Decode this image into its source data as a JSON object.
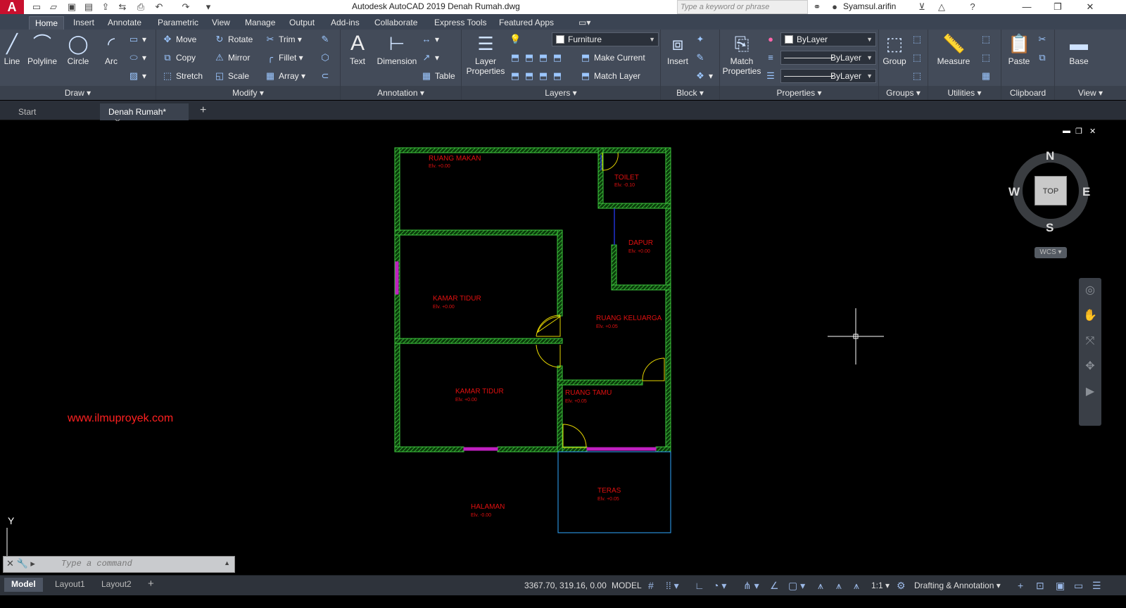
{
  "titlebar": {
    "app_logo": "A",
    "title": "Autodesk AutoCAD 2019    Denah Rumah.dwg",
    "search_placeholder": "Type a keyword or phrase",
    "user": "Syamsul.arifin"
  },
  "ribbon_tabs": [
    "Home",
    "Insert",
    "Annotate",
    "Parametric",
    "View",
    "Manage",
    "Output",
    "Add-ins",
    "Collaborate",
    "Express Tools",
    "Featured Apps"
  ],
  "draw": {
    "title": "Draw",
    "tools": [
      "Line",
      "Polyline",
      "Circle",
      "Arc"
    ]
  },
  "modify": {
    "title": "Modify",
    "tools": [
      "Move",
      "Rotate",
      "Trim",
      "Copy",
      "Mirror",
      "Fillet",
      "Stretch",
      "Scale",
      "Array"
    ]
  },
  "annotation": {
    "title": "Annotation",
    "text": "Text",
    "dimension": "Dimension",
    "table": "Table"
  },
  "layers": {
    "title": "Layers",
    "layer_properties": "Layer Properties",
    "current_layer": "Furniture",
    "make_current": "Make Current",
    "match_layer": "Match Layer"
  },
  "block": {
    "title": "Block",
    "insert": "Insert"
  },
  "properties": {
    "title": "Properties",
    "match_properties": "Match Properties",
    "color": "ByLayer",
    "linetype": "ByLayer",
    "lineweight": "ByLayer"
  },
  "groups": {
    "title": "Groups",
    "group": "Group"
  },
  "utilities": {
    "title": "Utilities",
    "measure": "Measure"
  },
  "clipboard": {
    "title": "Clipboard",
    "paste": "Paste"
  },
  "view_panel": {
    "title": "View",
    "base": "Base"
  },
  "doc_tabs": [
    "Start",
    "Denah Rumah*"
  ],
  "drawing": {
    "rooms": [
      {
        "name": "RUANG MAKAN",
        "elv": "Elv. +0.00"
      },
      {
        "name": "TOILET",
        "elv": "Elv. -0.10"
      },
      {
        "name": "DAPUR",
        "elv": "Elv. +0.00"
      },
      {
        "name": "KAMAR TIDUR",
        "elv": "Elv. +0.00"
      },
      {
        "name": "RUANG KELUARGA",
        "elv": "Elv. +0.05"
      },
      {
        "name": "KAMAR TIDUR",
        "elv": "Elv. +0.00"
      },
      {
        "name": "RUANG TAMU",
        "elv": "Elv. +0.05"
      },
      {
        "name": "TERAS",
        "elv": "Elv. +0.05"
      },
      {
        "name": "HALAMAN",
        "elv": "Elv. -0.00"
      }
    ],
    "watermark": "www.ilmuproyek.com",
    "ucs_y": "Y"
  },
  "viewcube": {
    "top": "TOP",
    "n": "N",
    "s": "S",
    "e": "E",
    "w": "W",
    "wcs": "WCS"
  },
  "command": {
    "placeholder": "Type a command"
  },
  "layout_tabs": [
    "Model",
    "Layout1",
    "Layout2"
  ],
  "status": {
    "coords": "3367.70, 319.16, 0.00",
    "mode": "MODEL",
    "scale": "1:1",
    "workspace": "Drafting & Annotation"
  }
}
